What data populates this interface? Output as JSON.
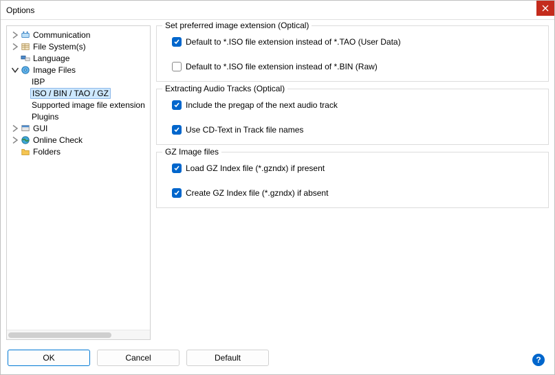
{
  "window": {
    "title": "Options"
  },
  "tree": {
    "items": [
      {
        "label": "Communication",
        "expandable": true
      },
      {
        "label": "File System(s)",
        "expandable": true
      },
      {
        "label": "Language",
        "expandable": false
      },
      {
        "label": "Image Files",
        "expandable": true,
        "expanded": true
      },
      {
        "label": "IBP"
      },
      {
        "label": "ISO / BIN / TAO / GZ",
        "selected": true
      },
      {
        "label": "Supported image file extension"
      },
      {
        "label": "Plugins"
      },
      {
        "label": "GUI",
        "expandable": true
      },
      {
        "label": "Online Check",
        "expandable": true
      },
      {
        "label": "Folders",
        "expandable": false
      }
    ]
  },
  "groups": {
    "preferred": {
      "title": "Set preferred image extension (Optical)",
      "opt_tao": {
        "label": "Default to *.ISO file extension instead of *.TAO (User Data)",
        "checked": true
      },
      "opt_bin": {
        "label": "Default to *.ISO file extension instead of *.BIN (Raw)",
        "checked": false
      }
    },
    "extracting": {
      "title": "Extracting Audio Tracks (Optical)",
      "opt_pregap": {
        "label": "Include the pregap of the next audio track",
        "checked": true
      },
      "opt_cdtext": {
        "label": "Use CD-Text in Track file names",
        "checked": true
      }
    },
    "gz": {
      "title": "GZ Image files",
      "opt_load": {
        "label": "Load GZ Index file (*.gzndx) if present",
        "checked": true
      },
      "opt_create": {
        "label": "Create GZ Index file (*.gzndx) if absent",
        "checked": true
      }
    }
  },
  "buttons": {
    "ok": "OK",
    "cancel": "Cancel",
    "default": "Default",
    "help": "?"
  }
}
